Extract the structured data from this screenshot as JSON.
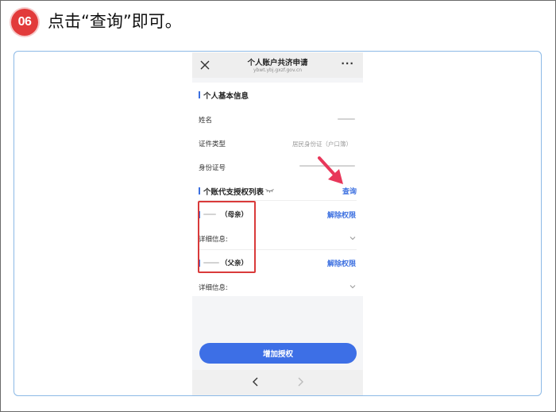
{
  "instruction": {
    "step_number": "06",
    "text": "点击“查询”即可。"
  },
  "window": {
    "title": "个人账户共济申请",
    "url": "ybwt.ybj.gxzf.gov.cn",
    "more_label": "···"
  },
  "basic_info": {
    "section_title": "个人基本信息",
    "name_label": "姓名",
    "id_type_label": "证件类型",
    "id_type_value": "居民身份证（户口簿）",
    "id_number_label": "身份证号"
  },
  "authorization": {
    "section_title": "个账代支授权列表",
    "query_label": "查询",
    "people": [
      {
        "relation": "（母亲）",
        "revoke_label": "解除权限",
        "details_label": "详细信息:"
      },
      {
        "relation": "（父亲）",
        "revoke_label": "解除权限",
        "details_label": "详细信息:"
      }
    ]
  },
  "add_button_label": "增加授权",
  "colors": {
    "accent": "#3b6fe0",
    "step_badge": "#e23b3b",
    "highlight": "#d93a3a",
    "arrow": "#e8375a"
  },
  "icons": [
    "close-icon",
    "more-icon",
    "eye-closed-icon",
    "chevron-down-icon",
    "back-arrow-icon",
    "forward-arrow-icon"
  ]
}
